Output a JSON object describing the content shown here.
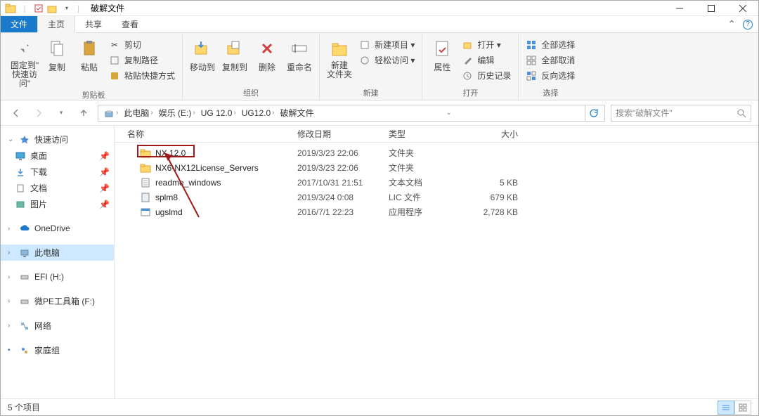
{
  "window": {
    "title": "破解文件"
  },
  "tabs": {
    "file": "文件",
    "home": "主页",
    "share": "共享",
    "view": "查看"
  },
  "ribbon": {
    "clipboard": {
      "pin": "固定到\"\n快速访问\"",
      "copy": "复制",
      "paste": "粘贴",
      "cut": "剪切",
      "copy_path": "复制路径",
      "paste_shortcut": "粘贴快捷方式",
      "label": "剪贴板"
    },
    "organize": {
      "move_to": "移动到",
      "copy_to": "复制到",
      "delete": "删除",
      "rename": "重命名",
      "label": "组织"
    },
    "new": {
      "new_folder": "新建\n文件夹",
      "new_item": "新建项目 ▾",
      "easy_access": "轻松访问 ▾",
      "label": "新建"
    },
    "open": {
      "properties": "属性",
      "open": "打开 ▾",
      "edit": "编辑",
      "history": "历史记录",
      "label": "打开"
    },
    "select": {
      "select_all": "全部选择",
      "select_none": "全部取消",
      "invert": "反向选择",
      "label": "选择"
    }
  },
  "breadcrumb": {
    "segments": [
      "此电脑",
      "娱乐 (E:)",
      "UG 12.0",
      "UG12.0",
      "破解文件"
    ]
  },
  "search": {
    "placeholder": "搜索\"破解文件\""
  },
  "nav": {
    "quick_access": "快速访问",
    "desktop": "桌面",
    "downloads": "下载",
    "documents": "文档",
    "pictures": "图片",
    "onedrive": "OneDrive",
    "this_pc": "此电脑",
    "efi": "EFI (H:)",
    "wepe": "微PE工具箱 (F:)",
    "network": "网络",
    "homegroup": "家庭组"
  },
  "columns": {
    "name": "名称",
    "date": "修改日期",
    "type": "类型",
    "size": "大小"
  },
  "files": [
    {
      "name": "NX 12.0",
      "date": "2019/3/23 22:06",
      "type": "文件夹",
      "size": "",
      "icon": "folder"
    },
    {
      "name": "NX6-NX12License_Servers",
      "date": "2019/3/23 22:06",
      "type": "文件夹",
      "size": "",
      "icon": "folder"
    },
    {
      "name": "readme_windows",
      "date": "2017/10/31 21:51",
      "type": "文本文档",
      "size": "5 KB",
      "icon": "text"
    },
    {
      "name": "splm8",
      "date": "2019/3/24 0:08",
      "type": "LIC 文件",
      "size": "679 KB",
      "icon": "file"
    },
    {
      "name": "ugslmd",
      "date": "2016/7/1 22:23",
      "type": "应用程序",
      "size": "2,728 KB",
      "icon": "exe"
    }
  ],
  "status": {
    "count": "5 个项目"
  }
}
